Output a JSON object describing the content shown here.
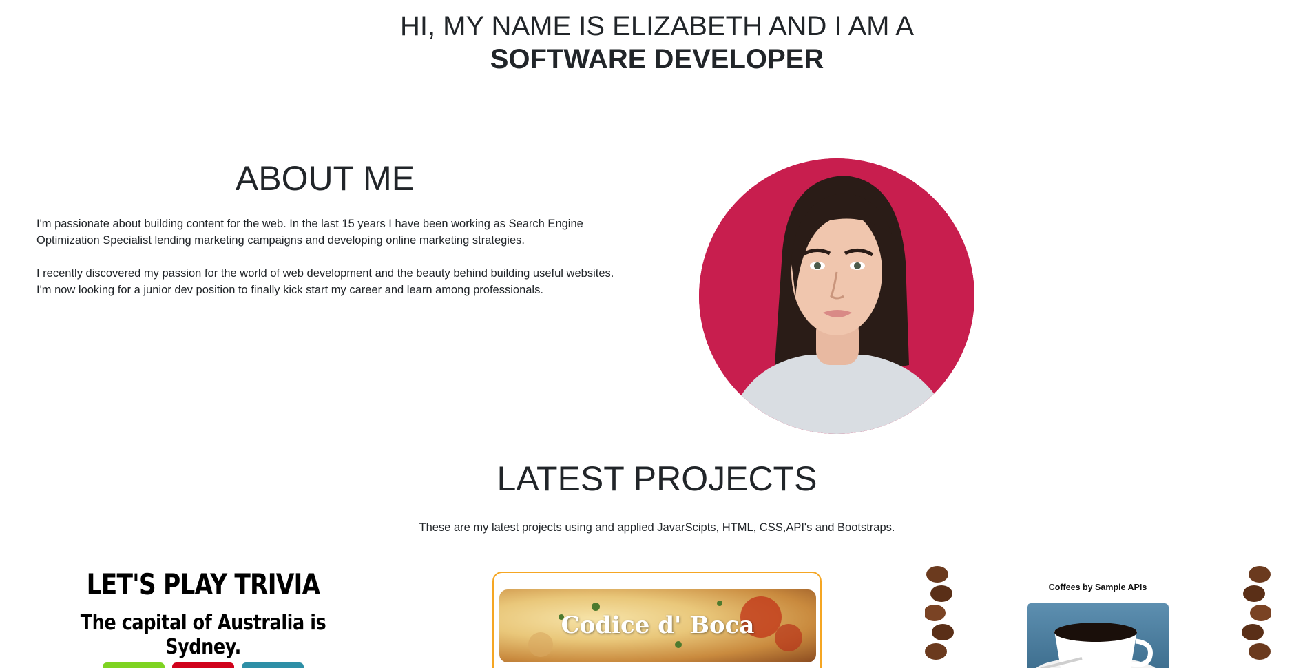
{
  "hero": {
    "line1": "HI, MY NAME IS ELIZABETH AND I AM A",
    "line2": "SOFTWARE DEVELOPER"
  },
  "about": {
    "heading": "ABOUT ME",
    "paragraph1_line1": "I'm passionate about building content for the web. In the last 15 years I have been working as Search Engine",
    "paragraph1_line2": "Optimization Specialist lending marketing campaigns and developing online marketing strategies.",
    "paragraph2_line1": "I recently discovered my passion for the world of web development and the beauty behind building useful websites.",
    "paragraph2_line2": "I'm now looking for a junior dev position to finally kick start my career and learn among professionals."
  },
  "projects": {
    "heading": "LATEST PROJECTS",
    "subtitle": "These are my latest projects using and applied JavarScipts, HTML, CSS,API's and Bootstraps.",
    "trivia": {
      "title": "LET'S PLAY TRIVIA",
      "question": "The capital of Australia is Sydney.",
      "button_colors": [
        "#7ed321",
        "#d0021b",
        "#2e8fa6"
      ]
    },
    "pizza": {
      "name": "Codice d' Boca",
      "border_color": "#f5a623"
    },
    "coffee": {
      "title": "Coffees by Sample APIs"
    }
  },
  "colors": {
    "portrait_bg": "#c81e4e",
    "text": "#212529"
  }
}
